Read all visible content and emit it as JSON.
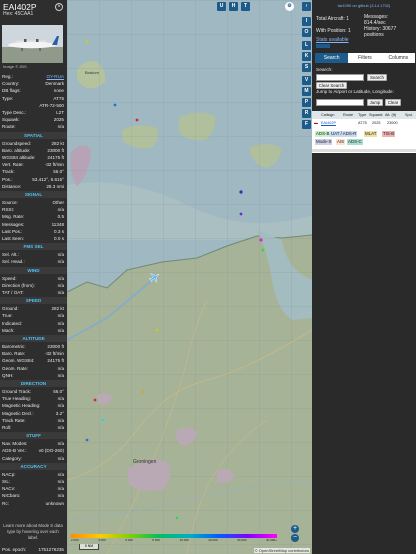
{
  "aircraft": {
    "callsign": "EAI402P",
    "hex_label": "Hex:",
    "hex": "45CAA1",
    "image_caption": "Image © JBS"
  },
  "info": [
    {
      "k": "Reg.:",
      "v": "OY-RUA"
    },
    {
      "k": "Country:",
      "v": "Denmark"
    },
    {
      "k": "DB flags:",
      "v": "none"
    },
    {
      "k": "Type:",
      "v": "AT75"
    },
    {
      "k": "",
      "v": "ATR-72-500"
    },
    {
      "k": "Type Desc.:",
      "v": "L2T"
    },
    {
      "k": "Squawk:",
      "v": "2025"
    },
    {
      "k": "Route:",
      "v": "n/a"
    }
  ],
  "sections": {
    "spatial": "SPATIAL",
    "signal": "SIGNAL",
    "fms": "FMS SEL",
    "wind": "WIND",
    "speed": "SPEED",
    "altitude": "ALTITUDE",
    "direction": "DIRECTION",
    "stuff": "STUFF",
    "accuracy": "ACCURACY"
  },
  "spatial": [
    {
      "k": "Groundspeed:",
      "v": "282 kt"
    },
    {
      "k": "Baro. altitude:",
      "v": "23000 ft"
    },
    {
      "k": "WGS84 altitude:",
      "v": "24175 ft"
    },
    {
      "k": "Vert. Rate:",
      "v": "-32 ft/min"
    },
    {
      "k": "Track:",
      "v": "56.0°"
    },
    {
      "k": "Pos.:",
      "v": "53.412°, 6.615°"
    },
    {
      "k": "Distance:",
      "v": "28.3 nmi"
    }
  ],
  "signal": [
    {
      "k": "Source:",
      "v": "Other"
    },
    {
      "k": "RSSI:",
      "v": "n/a"
    },
    {
      "k": "Msg. Rate:",
      "v": "0.5"
    },
    {
      "k": "Messages:",
      "v": "11348"
    },
    {
      "k": "Last Pos.:",
      "v": "0.3 s"
    },
    {
      "k": "Last Seen:",
      "v": "0.0 s"
    }
  ],
  "fms": [
    {
      "k": "Sel. Alt.:",
      "v": "n/a"
    },
    {
      "k": "Sel. Head.:",
      "v": "n/a"
    }
  ],
  "wind": [
    {
      "k": "Speed:",
      "v": "n/a"
    },
    {
      "k": "Direction (from):",
      "v": "n/a"
    },
    {
      "k": "TAT / OAT:",
      "v": "n/a"
    }
  ],
  "speed": [
    {
      "k": "Ground:",
      "v": "282 kt"
    },
    {
      "k": "True:",
      "v": "n/a"
    },
    {
      "k": "Indicated:",
      "v": "n/a"
    },
    {
      "k": "Mach:",
      "v": "n/a"
    }
  ],
  "altitude": [
    {
      "k": "Barometric:",
      "v": "23000 ft"
    },
    {
      "k": "Baro. Rate:",
      "v": "-32 ft/min"
    },
    {
      "k": "Geom. WGS84:",
      "v": "24175 ft"
    },
    {
      "k": "Geom. Rate:",
      "v": "n/a"
    },
    {
      "k": "QNH:",
      "v": "n/a"
    }
  ],
  "direction": [
    {
      "k": "Ground Track:",
      "v": "56.0°"
    },
    {
      "k": "True Heading:",
      "v": "n/a"
    },
    {
      "k": "Magnetic Heading:",
      "v": "n/a"
    },
    {
      "k": "Magnetic Decl.:",
      "v": "3.2°"
    },
    {
      "k": "Track Rate:",
      "v": "n/a"
    },
    {
      "k": "Roll:",
      "v": "n/a"
    }
  ],
  "stuff": [
    {
      "k": "Nav. Modes:",
      "v": "n/a"
    },
    {
      "k": "ADS-B Ver.:",
      "v": "v0 (DO-260)"
    },
    {
      "k": "Category:",
      "v": "n/a"
    }
  ],
  "accuracy": [
    {
      "k": "NACp:",
      "v": "n/a"
    },
    {
      "k": "SIL:",
      "v": "n/a"
    },
    {
      "k": "NACv:",
      "v": "n/a"
    },
    {
      "k": "NICbaro:",
      "v": "n/a"
    },
    {
      "k": "Rc:",
      "v": "unknown"
    }
  ],
  "footer": {
    "more_text": "Learn more about Mode S data type by hovering over each label.",
    "pos_epoch_label": "Pos. epoch:",
    "pos_epoch": "1751276235"
  },
  "map": {
    "top_buttons": [
      "U",
      "H",
      "T"
    ],
    "side_buttons": [
      "I",
      "O",
      "L",
      "K",
      "S",
      "V",
      "M",
      "P",
      "R",
      "F"
    ],
    "legend_labels": [
      "2 000",
      "4 000",
      "6 000",
      "8 000",
      "10 000",
      "20 000",
      "30 000",
      "40 000+"
    ],
    "scale": "5 NM",
    "attribution": "© OpenStreetMap contributors",
    "places": {
      "borkum": "Borkum",
      "groningen": "Groningen"
    },
    "zoom_in": "+",
    "zoom_out": "−"
  },
  "right": {
    "top_link": "tar1090 on github (3.14.1702)",
    "total_label": "Total Aircraft: 1",
    "with_pos_label": "With Position: 1",
    "stats_label": "Stats available",
    "messages_label": "Messages:",
    "messages_rate": "814.4/sec",
    "history_label": "History: 30677",
    "history_sub": "positions",
    "tabs": [
      "Search",
      "Filters",
      "Columns"
    ],
    "search_label": "Search:",
    "search_button": "Search",
    "clear_search_button": "Clear Search",
    "jump_label": "Jump to Airport or Latitude, Longitude:",
    "jump_button": "Jump",
    "clear_button": "Clear",
    "table_headers": [
      "Callsign",
      "Route",
      "Type",
      "Squawk",
      "Alt. (ft)",
      "Spd."
    ],
    "table_row": [
      "EAI402P",
      "",
      "AT75",
      "2025",
      "23000",
      ""
    ],
    "source_tags": [
      {
        "label": "ADS-B",
        "color": "#c9f0c9"
      },
      {
        "label": "UAT / ADS-R",
        "color": "#c9d9f0"
      },
      {
        "label": "MLAT",
        "color": "#f0e0a0"
      },
      {
        "label": "TIS-B",
        "color": "#f0b0b0"
      },
      {
        "label": "Mode-S",
        "color": "#cfcfe8"
      },
      {
        "label": "AIS",
        "color": "#ffe0cc"
      },
      {
        "label": "ADS-C",
        "color": "#a8e0d0"
      }
    ]
  }
}
